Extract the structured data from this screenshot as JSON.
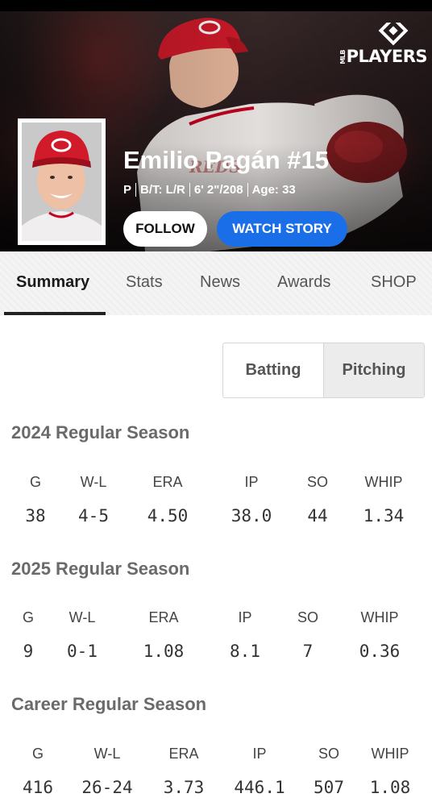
{
  "hero": {
    "logo_text": "PLAYERS",
    "logo_small": "MLB",
    "player_name": "Emilio Pagán #15",
    "position": "P",
    "bats_throws": "B/T: L/R",
    "height_weight": "6' 2\"/208",
    "age": "Age: 33",
    "follow_label": "FOLLOW",
    "watch_label": "WATCH STORY",
    "colors": {
      "team_red": "#c6011f",
      "watch_blue": "#1a6ee8"
    }
  },
  "tabs": [
    {
      "label": "Summary",
      "active": true
    },
    {
      "label": "Stats",
      "active": false
    },
    {
      "label": "News",
      "active": false
    },
    {
      "label": "Awards",
      "active": false
    },
    {
      "label": "SHOP",
      "active": false
    }
  ],
  "toggle": {
    "batting": "Batting",
    "pitching": "Pitching",
    "selected": "Pitching"
  },
  "seasons": [
    {
      "title": "2024 Regular Season",
      "headers": [
        "G",
        "W-L",
        "ERA",
        "IP",
        "SO",
        "WHIP"
      ],
      "values": [
        "38",
        "4-5",
        "4.50",
        "38.0",
        "44",
        "1.34"
      ]
    },
    {
      "title": "2025 Regular Season",
      "headers": [
        "G",
        "W-L",
        "ERA",
        "IP",
        "SO",
        "WHIP"
      ],
      "values": [
        "9",
        "0-1",
        "1.08",
        "8.1",
        "7",
        "0.36"
      ]
    },
    {
      "title": "Career Regular Season",
      "headers": [
        "G",
        "W-L",
        "ERA",
        "IP",
        "SO",
        "WHIP"
      ],
      "values": [
        "416",
        "26-24",
        "3.73",
        "446.1",
        "507",
        "1.08"
      ]
    }
  ]
}
